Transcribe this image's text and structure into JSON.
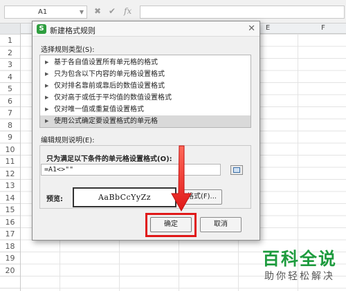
{
  "spreadsheet": {
    "name_box": "A1",
    "formula_icons": [
      "✖",
      "✔",
      "fx"
    ],
    "columns": [
      "E",
      "F"
    ],
    "rows": [
      "1",
      "2",
      "3",
      "4",
      "5",
      "6",
      "7",
      "8",
      "9",
      "10",
      "11",
      "12",
      "13",
      "14",
      "15",
      "16",
      "17",
      "18",
      "19",
      "20"
    ]
  },
  "dialog": {
    "title": "新建格式规则",
    "app_icon_letter": "S",
    "close_glyph": "✕",
    "rule_type_label": "选择规则类型(S):",
    "rule_types": [
      {
        "label": "基于各自值设置所有单元格的格式"
      },
      {
        "label": "只为包含以下内容的单元格设置格式"
      },
      {
        "label": "仅对排名靠前或靠后的数值设置格式"
      },
      {
        "label": "仅对高于或低于平均值的数值设置格式"
      },
      {
        "label": "仅对唯一值或重复值设置格式"
      },
      {
        "label": "使用公式确定要设置格式的单元格"
      }
    ],
    "selected_rule_index": 5,
    "description_label": "编辑规则说明(E):",
    "condition_label": "只为满足以下条件的单元格设置格式(O):",
    "formula_value": "=A1<>\"\"",
    "preview_label": "预览:",
    "preview_text": "AaBbCcYyZz",
    "format_button": "格式(F)...",
    "ok_button": "确定",
    "cancel_button": "取消"
  },
  "annotation": {
    "color": "#e01818"
  },
  "watermark": {
    "main": "百科全说",
    "sub": "助你轻松解决"
  },
  "colors": {
    "watermark_green": "#1e9b3e",
    "app_icon_green": "#2e9e3f"
  }
}
